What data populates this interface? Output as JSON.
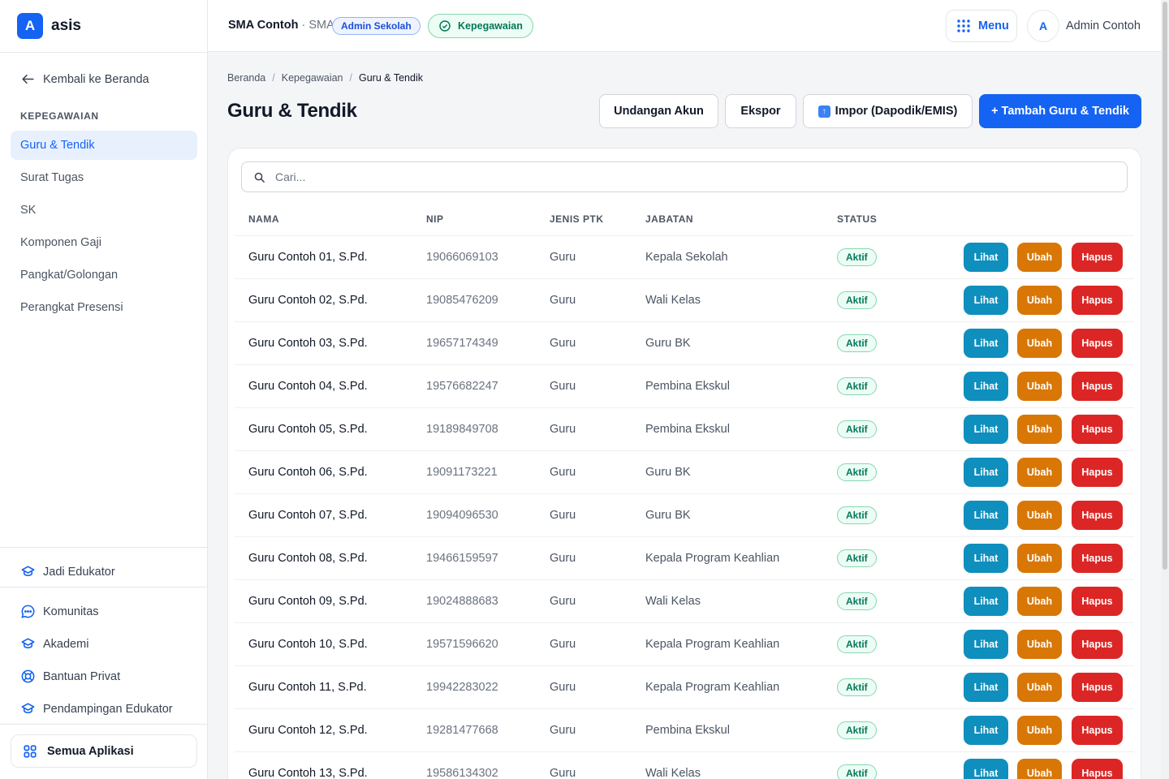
{
  "brand": {
    "logo_letter": "A",
    "name": "asis"
  },
  "sidebar": {
    "back_label": "Kembali ke Beranda",
    "section_label": "KEPEGAWAIAN",
    "items": [
      {
        "label": "Guru & Tendik",
        "active": true
      },
      {
        "label": "Surat Tugas",
        "active": false
      },
      {
        "label": "SK",
        "active": false
      },
      {
        "label": "Komponen Gaji",
        "active": false
      },
      {
        "label": "Pangkat/Golongan",
        "active": false
      },
      {
        "label": "Perangkat Presensi",
        "active": false
      }
    ],
    "educator_link": "Jadi Edukator",
    "bottom_links": [
      "Komunitas",
      "Akademi",
      "Bantuan Privat",
      "Pendampingan Edukator"
    ],
    "all_apps": "Semua Aplikasi"
  },
  "topbar": {
    "school_name": "SMA Contoh",
    "school_type": "· SMA",
    "role_badge": "Admin Sekolah",
    "module_badge": "Kepegawaian",
    "menu_label": "Menu",
    "avatar_letter": "A",
    "user_name": "Admin Contoh"
  },
  "breadcrumb": [
    "Beranda",
    "Kepegawaian",
    "Guru & Tendik"
  ],
  "page_title": "Guru & Tendik",
  "actions": {
    "invite": "Undangan Akun",
    "export": "Ekspor",
    "import": "Impor (Dapodik/EMIS)",
    "add": "+ Tambah Guru & Tendik"
  },
  "search": {
    "placeholder": "Cari..."
  },
  "table": {
    "headers": [
      "NAMA",
      "NIP",
      "JENIS PTK",
      "JABATAN",
      "STATUS"
    ],
    "action_labels": {
      "view": "Lihat",
      "edit": "Ubah",
      "delete": "Hapus"
    },
    "rows": [
      {
        "nama": "Guru Contoh 01, S.Pd.",
        "nip": "19066069103",
        "jenis": "Guru",
        "jabatan": "Kepala Sekolah",
        "status": "Aktif"
      },
      {
        "nama": "Guru Contoh 02, S.Pd.",
        "nip": "19085476209",
        "jenis": "Guru",
        "jabatan": "Wali Kelas",
        "status": "Aktif"
      },
      {
        "nama": "Guru Contoh 03, S.Pd.",
        "nip": "19657174349",
        "jenis": "Guru",
        "jabatan": "Guru BK",
        "status": "Aktif"
      },
      {
        "nama": "Guru Contoh 04, S.Pd.",
        "nip": "19576682247",
        "jenis": "Guru",
        "jabatan": "Pembina Ekskul",
        "status": "Aktif"
      },
      {
        "nama": "Guru Contoh 05, S.Pd.",
        "nip": "19189849708",
        "jenis": "Guru",
        "jabatan": "Pembina Ekskul",
        "status": "Aktif"
      },
      {
        "nama": "Guru Contoh 06, S.Pd.",
        "nip": "19091173221",
        "jenis": "Guru",
        "jabatan": "Guru BK",
        "status": "Aktif"
      },
      {
        "nama": "Guru Contoh 07, S.Pd.",
        "nip": "19094096530",
        "jenis": "Guru",
        "jabatan": "Guru BK",
        "status": "Aktif"
      },
      {
        "nama": "Guru Contoh 08, S.Pd.",
        "nip": "19466159597",
        "jenis": "Guru",
        "jabatan": "Kepala Program Keahlian",
        "status": "Aktif"
      },
      {
        "nama": "Guru Contoh 09, S.Pd.",
        "nip": "19024888683",
        "jenis": "Guru",
        "jabatan": "Wali Kelas",
        "status": "Aktif"
      },
      {
        "nama": "Guru Contoh 10, S.Pd.",
        "nip": "19571596620",
        "jenis": "Guru",
        "jabatan": "Kepala Program Keahlian",
        "status": "Aktif"
      },
      {
        "nama": "Guru Contoh 11, S.Pd.",
        "nip": "19942283022",
        "jenis": "Guru",
        "jabatan": "Kepala Program Keahlian",
        "status": "Aktif"
      },
      {
        "nama": "Guru Contoh 12, S.Pd.",
        "nip": "19281477668",
        "jenis": "Guru",
        "jabatan": "Pembina Ekskul",
        "status": "Aktif"
      },
      {
        "nama": "Guru Contoh 13, S.Pd.",
        "nip": "19586134302",
        "jenis": "Guru",
        "jabatan": "Wali Kelas",
        "status": "Aktif"
      }
    ]
  },
  "colors": {
    "accent": "#1463f3",
    "view": "#0f8fbd",
    "edit": "#d97706",
    "delete": "#dc2626",
    "status": "#047857"
  },
  "icons": [
    "arrow-left-icon",
    "layers-icon",
    "chat-icon",
    "lifebuoy-icon",
    "grid-icon",
    "search-icon",
    "check-circle-icon",
    "dots-grid-icon",
    "upload-icon"
  ]
}
